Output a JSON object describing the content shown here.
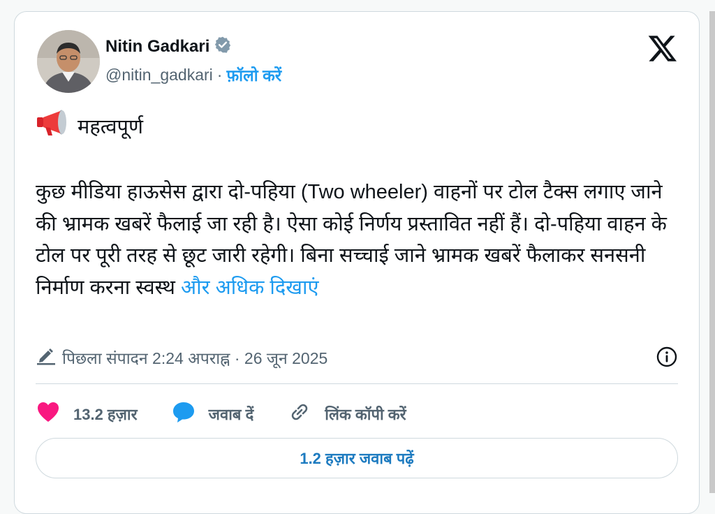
{
  "author": {
    "name": "Nitin Gadkari",
    "handle": "@nitin_gadkari",
    "separator": "·",
    "follow_label": "फ़ॉलो करें"
  },
  "tweet": {
    "headline": "महत्वपूर्ण",
    "body": "कुछ मीडिया हाऊसेस  द्वारा दो-पहिया (Two wheeler) वाहनों पर टोल टैक्स लगाए जाने की भ्रामक खबरें फैलाई जा रही है। ऐसा कोई निर्णय प्रस्तावित नहीं हैं। दो-पहिया वाहन के टोल पर पूरी तरह से छूट जारी रहेगी। बिना सच्चाई जाने भ्रामक खबरें फैलाकर सनसनी निर्माण करना स्वस्थ",
    "show_more": "और अधिक दिखाएं",
    "edited_label": "पिछला संपादन 2:24 अपराह्न · 26 जून 2025"
  },
  "actions": {
    "likes": "13.2 हज़ार",
    "reply": "जवाब दें",
    "copy_link": "लिंक कॉपी करें"
  },
  "read_replies": "1.2 हज़ार जवाब पढ़ें",
  "icons": [
    "verified-badge-icon",
    "x-logo-icon",
    "megaphone-icon",
    "pencil-icon",
    "info-icon",
    "heart-icon",
    "reply-bubble-icon",
    "link-icon"
  ],
  "colors": {
    "accent": "#1d9bf0",
    "like": "#f91880",
    "muted": "#536471"
  }
}
